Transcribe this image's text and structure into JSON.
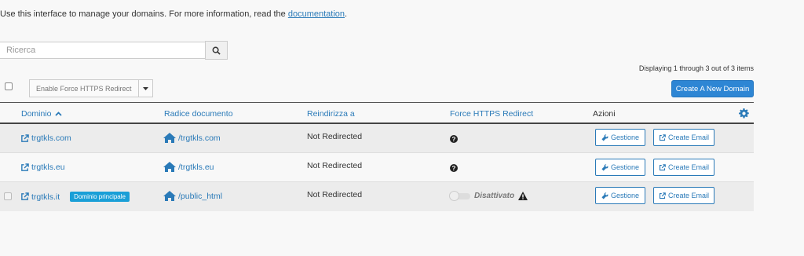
{
  "intro": {
    "text": "Use this interface to manage your domains. For more information, read the ",
    "link_text": "documentation",
    "tail": "."
  },
  "search": {
    "placeholder": "Ricerca"
  },
  "pagination": {
    "displaying": "Displaying 1 through 3 out of 3 items"
  },
  "toolbar": {
    "bulk_action_label": "Enable Force HTTPS Redirect",
    "create_domain_label": "Create A New Domain"
  },
  "table": {
    "columns": {
      "domain": "Dominio",
      "docroot": "Radice documento",
      "redirect": "Reindirizza a",
      "https": "Force HTTPS Redirect",
      "actions": "Azioni"
    },
    "rows": [
      {
        "domain": "trgtkls.com",
        "docroot": "/trgtkls.com",
        "redirect": "Not Redirected",
        "manage": "Gestione",
        "email": "Create Email"
      },
      {
        "domain": "trgtkls.eu",
        "docroot": "/trgtkls.eu",
        "redirect": "Not Redirected",
        "manage": "Gestione",
        "email": "Create Email"
      },
      {
        "domain": "trgtkls.it",
        "badge": "Dominio principale",
        "docroot": "/public_html",
        "redirect": "Not Redirected",
        "https_status": "Disattivato",
        "manage": "Gestione",
        "email": "Create Email"
      }
    ]
  },
  "colors": {
    "accent": "#2a7ab8",
    "primary_button": "#2e86d4",
    "badge": "#1a9fd7"
  }
}
